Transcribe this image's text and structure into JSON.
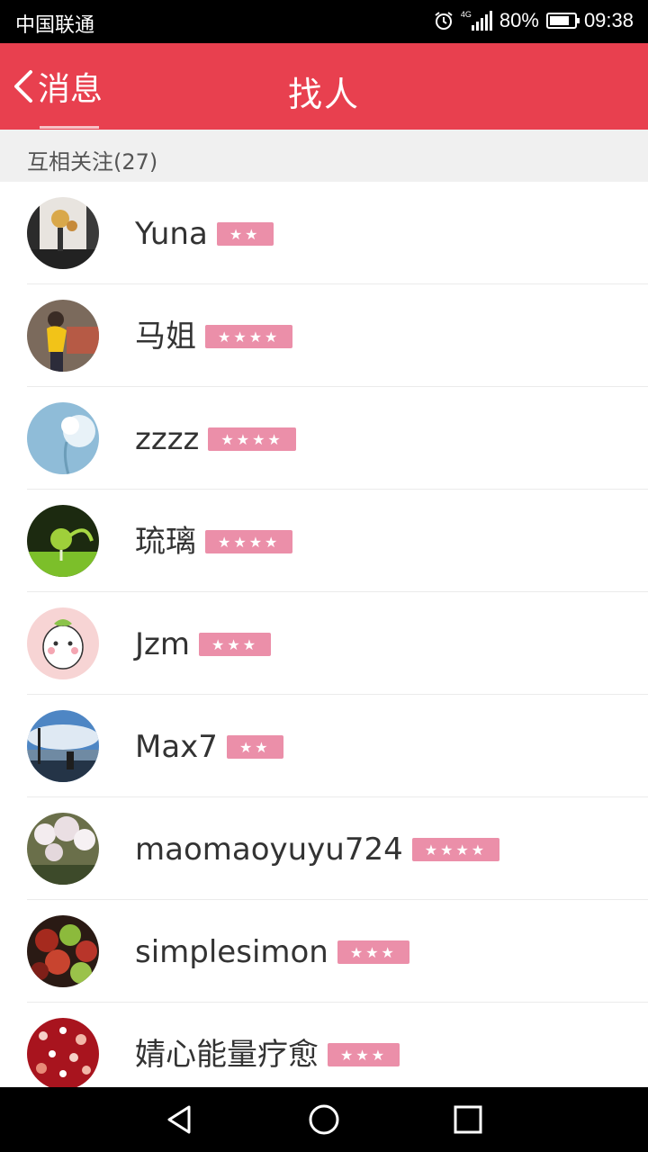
{
  "status_bar": {
    "carrier": "中国联通",
    "network": "4G",
    "battery_percent": "80%",
    "battery_level": 0.8,
    "time": "09:38",
    "icons": [
      "alarm-icon",
      "signal-icon",
      "battery-icon"
    ]
  },
  "header": {
    "back_label": "消息",
    "title": "找人",
    "background": "#e8404f"
  },
  "section": {
    "title": "互相关注(27)"
  },
  "contacts": [
    {
      "name": "Yuna",
      "stars": "★★",
      "star_count": 2
    },
    {
      "name": "马姐",
      "stars": "★★★★",
      "star_count": 4
    },
    {
      "name": "zzzz",
      "stars": "★★★★",
      "star_count": 4
    },
    {
      "name": "琉璃",
      "stars": "★★★★",
      "star_count": 4
    },
    {
      "name": "Jzm",
      "stars": "★★★",
      "star_count": 3
    },
    {
      "name": "Max7",
      "stars": "★★",
      "star_count": 2
    },
    {
      "name": "maomaoyuyu724",
      "stars": "★★★★",
      "star_count": 4
    },
    {
      "name": "simplesimon",
      "stars": "★★★",
      "star_count": 3
    },
    {
      "name": "婧心能量疗愈",
      "stars": "★★★",
      "star_count": 3
    }
  ],
  "badge_color": "#eb8fa9",
  "nav_bar": {
    "icons": [
      "back-icon",
      "home-icon",
      "recents-icon"
    ]
  }
}
